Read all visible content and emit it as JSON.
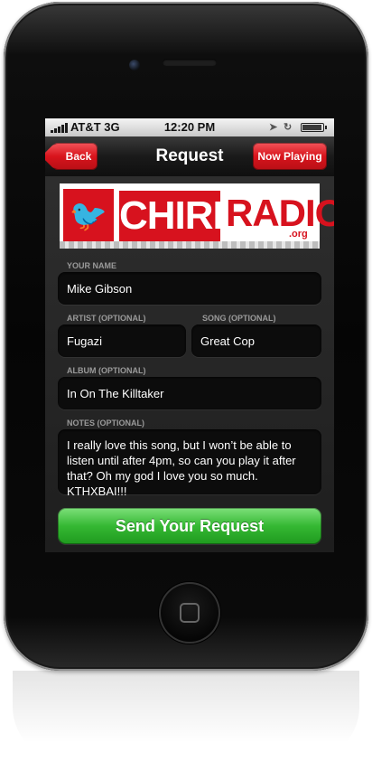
{
  "status_bar": {
    "carrier": "AT&T 3G",
    "time": "12:20 PM"
  },
  "nav": {
    "back_label": "Back",
    "title": "Request",
    "now_playing_label": "Now Playing"
  },
  "logo": {
    "chirp": "CHIRP",
    "radio": "RADIO",
    "org": ".org"
  },
  "form": {
    "name_label": "YOUR NAME",
    "name_value": "Mike Gibson",
    "artist_label": "ARTIST (OPTIONAL)",
    "artist_value": "Fugazi",
    "song_label": "SONG (OPTIONAL)",
    "song_value": "Great Cop",
    "album_label": "ALBUM (OPTIONAL)",
    "album_value": "In On The Killtaker",
    "notes_label": "NOTES (OPTIONAL)",
    "notes_value": "I really love this song, but I won’t be able to listen until after 4pm, so can you play it after that? Oh my god I love you so much. KTHXBAI!!!",
    "submit_label": "Send Your Request"
  },
  "colors": {
    "brand_red": "#d7121e",
    "submit_green": "#35b833"
  }
}
